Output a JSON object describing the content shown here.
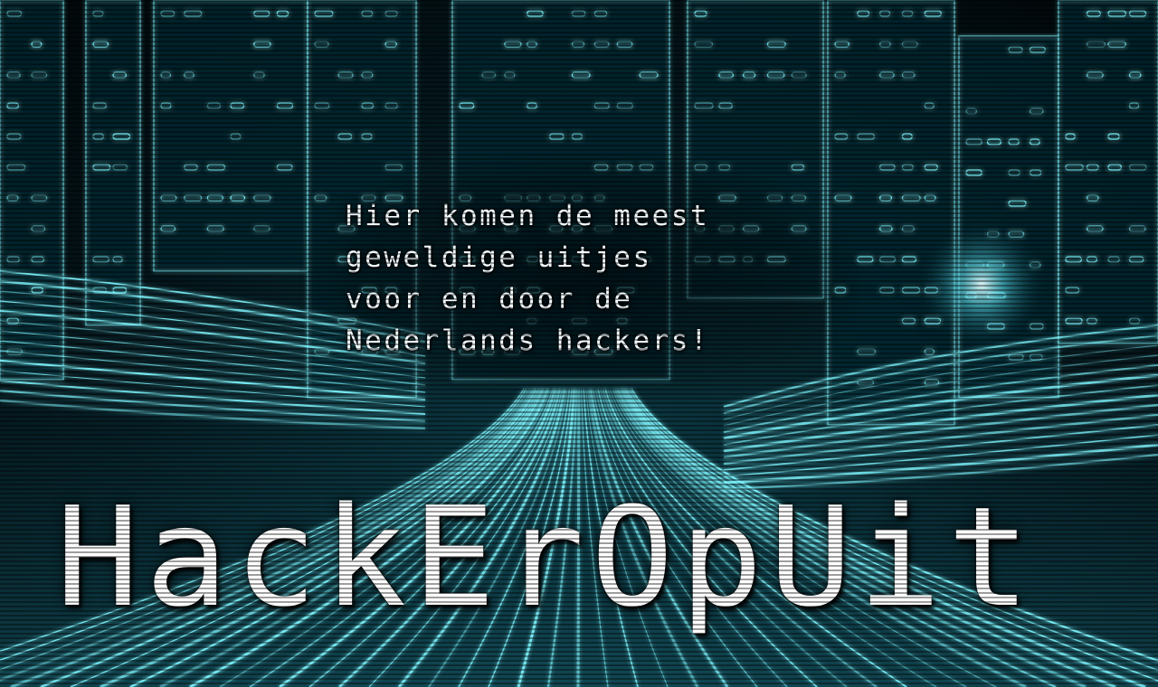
{
  "hero": {
    "tagline_lines": [
      "Hier komen de meest",
      "geweldige uitjes",
      "voor en door de",
      "Nederlands hackers!"
    ],
    "brand": "HackErOpUit"
  },
  "colors": {
    "neon": "#7ff6ff",
    "deep": "#04161c",
    "text": "#ffffff"
  }
}
